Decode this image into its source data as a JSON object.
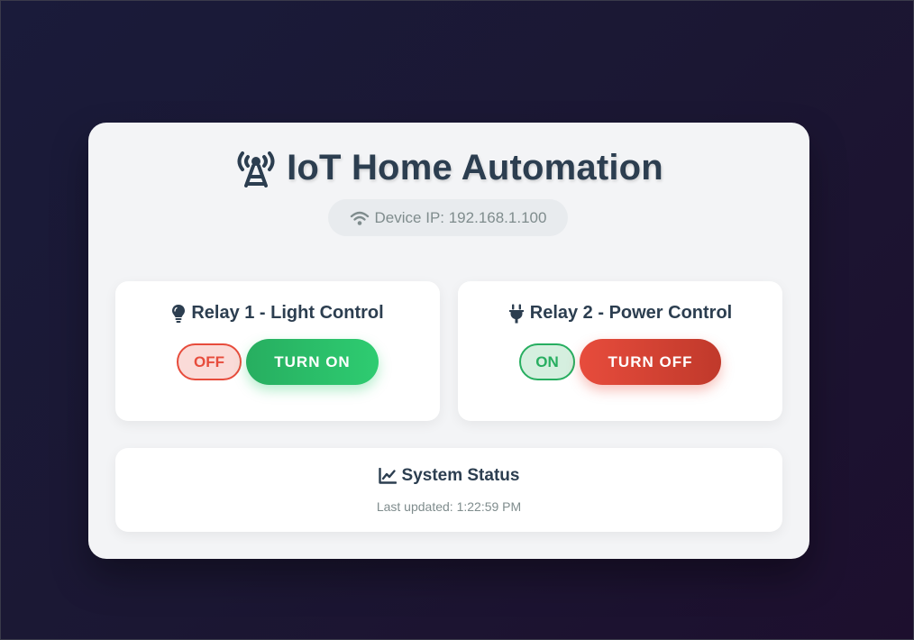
{
  "header": {
    "title": "IoT Home Automation",
    "title_icon": "broadcast-tower-icon",
    "device_ip_label": "Device IP: 192.168.1.100",
    "ip_icon": "wifi-icon"
  },
  "relays": [
    {
      "title": "Relay 1 - Light Control",
      "icon": "lightbulb-icon",
      "status": "OFF",
      "button_label": "TURN ON",
      "status_color": "#e74c3c",
      "button_color": "#2ecc71"
    },
    {
      "title": "Relay 2 - Power Control",
      "icon": "plug-icon",
      "status": "ON",
      "button_label": "TURN OFF",
      "status_color": "#27ae60",
      "button_color": "#e74c3c"
    }
  ],
  "system_status": {
    "title": "System Status",
    "icon": "line-chart-icon",
    "last_updated": "Last updated: 1:22:59 PM"
  },
  "colors": {
    "heading": "#2c3e50",
    "muted": "#7f8c8d",
    "background_start": "#1a1b3a",
    "background_end": "#1d0f2e"
  }
}
